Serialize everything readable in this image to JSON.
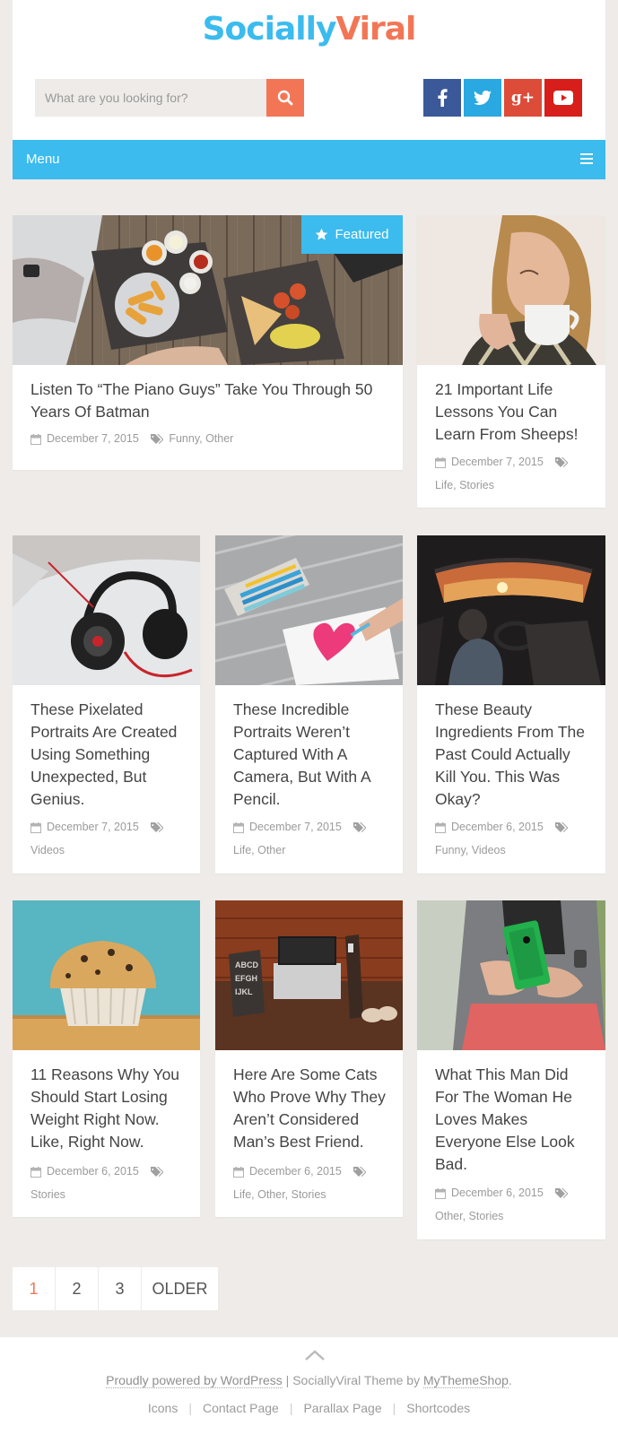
{
  "site": {
    "logo_part1": "Socially",
    "logo_part2": "Viral",
    "search_placeholder": "What are you looking for?",
    "social": [
      {
        "icon": "facebook-icon",
        "glyph": "f"
      },
      {
        "icon": "twitter-icon",
        "glyph": "t"
      },
      {
        "icon": "google-plus-icon",
        "glyph": "g+"
      },
      {
        "icon": "youtube-icon",
        "glyph": "▶"
      }
    ]
  },
  "menu": {
    "label": "Menu",
    "icon": "hamburger-icon"
  },
  "featured_badge": "Featured",
  "posts": [
    {
      "title": "Listen To “The Piano Guys” Take You Through 50 Years Of Batman",
      "date": "December 7, 2015",
      "categories": "Funny, Other",
      "featured": true
    },
    {
      "title": "21 Important Life Lessons You Can Learn From Sheeps!",
      "date": "December 7, 2015",
      "categories": "Life, Stories"
    },
    {
      "title": "These Pixelated Portraits Are Created Using Something Unexpected, But Genius.",
      "date": "December 7, 2015",
      "categories": "Videos"
    },
    {
      "title": "These Incredible Portraits Weren’t Captured With A Camera, But With A Pencil.",
      "date": "December 7, 2015",
      "categories": "Life, Other"
    },
    {
      "title": "These Beauty Ingredients From The Past Could Actually Kill You. This Was Okay?",
      "date": "December 6, 2015",
      "categories": "Funny, Videos"
    },
    {
      "title": "11 Reasons Why You Should Start Losing Weight Right Now. Like, Right Now.",
      "date": "December 6, 2015",
      "categories": "Stories"
    },
    {
      "title": "Here Are Some Cats Who Prove Why They Aren’t Considered Man’s Best Friend.",
      "date": "December 6, 2015",
      "categories": "Life, Other, Stories"
    },
    {
      "title": "What This Man Did For The Woman He Loves Makes Everyone Else Look Bad.",
      "date": "December 6, 2015",
      "categories": "Other, Stories"
    }
  ],
  "pagination": {
    "pages": [
      "1",
      "2",
      "3"
    ],
    "current": "1",
    "older": "OLDER"
  },
  "footer": {
    "powered": "Proudly powered by WordPress",
    "sep": " | ",
    "theme": "SociallyViral Theme by ",
    "theme_author": "MyThemeShop",
    "dot": ".",
    "links": [
      "Icons",
      "Contact Page",
      "Parallax Page",
      "Shortcodes"
    ]
  },
  "colors": {
    "accent_blue": "#3bbbee",
    "accent_orange": "#f27656",
    "background": "#eeebe8"
  }
}
